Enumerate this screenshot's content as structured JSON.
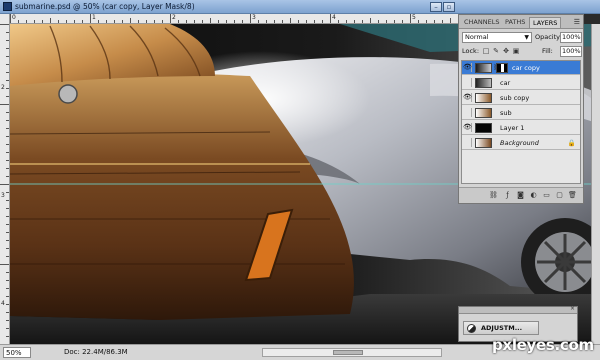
{
  "window": {
    "title": "submarine.psd @ 50% (car copy, Layer Mask/8)"
  },
  "rulers": {
    "top_numbers": [
      "0",
      "1",
      "2",
      "3",
      "4",
      "5"
    ],
    "left_numbers": [
      "2",
      "3",
      "4"
    ]
  },
  "layers_panel": {
    "tabs": [
      "CHANNELS",
      "PATHS",
      "LAYERS"
    ],
    "active_tab": "LAYERS",
    "blend_mode": "Normal",
    "opacity_label": "Opacity:",
    "opacity_value": "100%",
    "lock_label": "Lock:",
    "fill_label": "Fill:",
    "fill_value": "100%",
    "layers": [
      {
        "name": "car copy",
        "visible": true,
        "selected": true,
        "has_mask": true
      },
      {
        "name": "car",
        "visible": false,
        "selected": false,
        "has_mask": false
      },
      {
        "name": "sub copy",
        "visible": true,
        "selected": false,
        "has_mask": false
      },
      {
        "name": "sub",
        "visible": false,
        "selected": false,
        "has_mask": false
      },
      {
        "name": "Layer 1",
        "visible": true,
        "selected": false,
        "has_mask": false
      },
      {
        "name": "Background",
        "visible": false,
        "selected": false,
        "has_mask": false,
        "locked": true
      }
    ]
  },
  "adjustments_panel": {
    "button_label": "ADJUSTM..."
  },
  "status_bar": {
    "zoom": "50%",
    "doc_info": "Doc: 22.4M/86.3M"
  },
  "watermark": "pxleyes.com",
  "colors": {
    "selected_layer": "#3a7bd5",
    "titlebar": "#8fb0da",
    "panel_bg": "#d4d4d4"
  }
}
